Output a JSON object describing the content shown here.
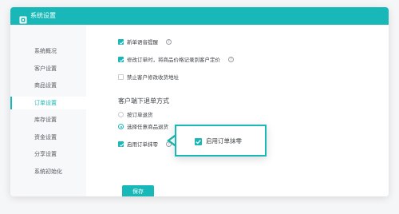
{
  "window": {
    "title": "系统设置",
    "accent_color": "#18b8b8"
  },
  "sidebar": {
    "items": [
      {
        "label": "系统概况",
        "active": false
      },
      {
        "label": "客户设置",
        "active": false
      },
      {
        "label": "商品设置",
        "active": false
      },
      {
        "label": "订单设置",
        "active": true
      },
      {
        "label": "库存设置",
        "active": false
      },
      {
        "label": "资金设置",
        "active": false
      },
      {
        "label": "分享设置",
        "active": false
      },
      {
        "label": "系统初始化",
        "active": false
      }
    ]
  },
  "settings": {
    "options": [
      {
        "label": "新单语音提醒",
        "checked": true,
        "help_icon": "question-circle-icon"
      },
      {
        "label": "修改订单时，将商品价格记录到客户定价",
        "checked": true,
        "help_icon": "question-circle-icon"
      },
      {
        "label": "禁止客户修改收货地址",
        "checked": false
      }
    ],
    "return_section": {
      "title": "客户端下退单方式",
      "options": [
        {
          "label": "按订单退货",
          "selected": false
        },
        {
          "label": "选择任意商品退货",
          "selected": true
        }
      ]
    },
    "rounding": {
      "label": "启用订单抹零",
      "checked": true,
      "help_icon": "question-circle-icon"
    },
    "help_glyph": "?"
  },
  "callout": {
    "label": "启用订单抹零",
    "checked": true
  },
  "actions": {
    "save_label": "保存"
  }
}
